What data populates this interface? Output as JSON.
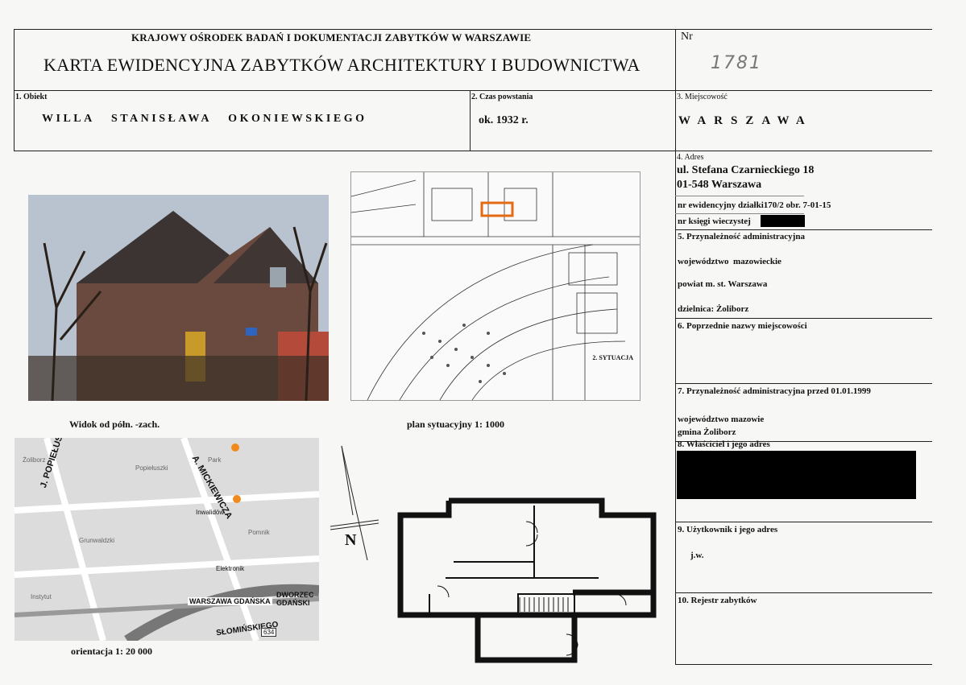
{
  "header": {
    "institution": "KRAJOWY OŚRODEK BADAŃ I DOKUMENTACJI ZABYTKÓW W WARSZAWIE",
    "title": "KARTA EWIDENCYJNA ZABYTKÓW ARCHITEKTURY I BUDOWNICTWA",
    "nr_label": "Nr",
    "nr_value": "1781"
  },
  "row1": {
    "obiekt_label": "1. Obiekt",
    "obiekt_value": "WILLA   STANISŁAWA   OKONIEWSKIEGO",
    "czas_label": "2. Czas powstania",
    "czas_value": "ok. 1932 r.",
    "miejscowosc_label": "3. Miejscowość",
    "miejscowosc_value": "WARSZAWA"
  },
  "right": {
    "adres_label": "4. Adres",
    "adres_line1": "ul. Stefana Czarnieckiego 18",
    "adres_line2": "01-548 Warszawa",
    "nr_dzialki": "nr ewidencyjny działki170/2 obr. 7-01-15",
    "nr_ksiegi": "nr księgi wieczystej",
    "przynaleznosc_label": "5. Przynależność administracyjna",
    "wojewodztwo": "województwo  mazowieckie",
    "powiat": "powiat m. st. Warszawa",
    "dzielnica": "dzielnica: Żoliborz",
    "poprzednie_label": "6. Poprzednie nazwy miejscowości",
    "przed1999_label": "7. Przynależność administracyjna przed 01.01.1999",
    "woj_przed": "województwo mazowie",
    "gmina_przed": "gmina Żoliborz",
    "wlasciciel_label": "8. Właściciel i jego adres",
    "uzytkownik_label": "9. Użytkownik i jego adres",
    "uzytkownik_value": "j.w.",
    "rejestr_label": "10. Rejestr zabytków"
  },
  "captions": {
    "photo": "Widok od półn. -zach.",
    "plan": "plan sytuacyjny 1: 1000",
    "map": "orientacja 1: 20 000",
    "north": "N",
    "sytuacja": "2. SYTUACJA"
  },
  "map_labels": [
    "J. POPIEŁUSZKI",
    "A. MICKIEWICZA",
    "WARSZAWA GDAŃSKA",
    "DWORZEC GDAŃSKI",
    "SŁOMIŃSKIEGO",
    "Inwalidów",
    "Elektronik",
    "634"
  ]
}
